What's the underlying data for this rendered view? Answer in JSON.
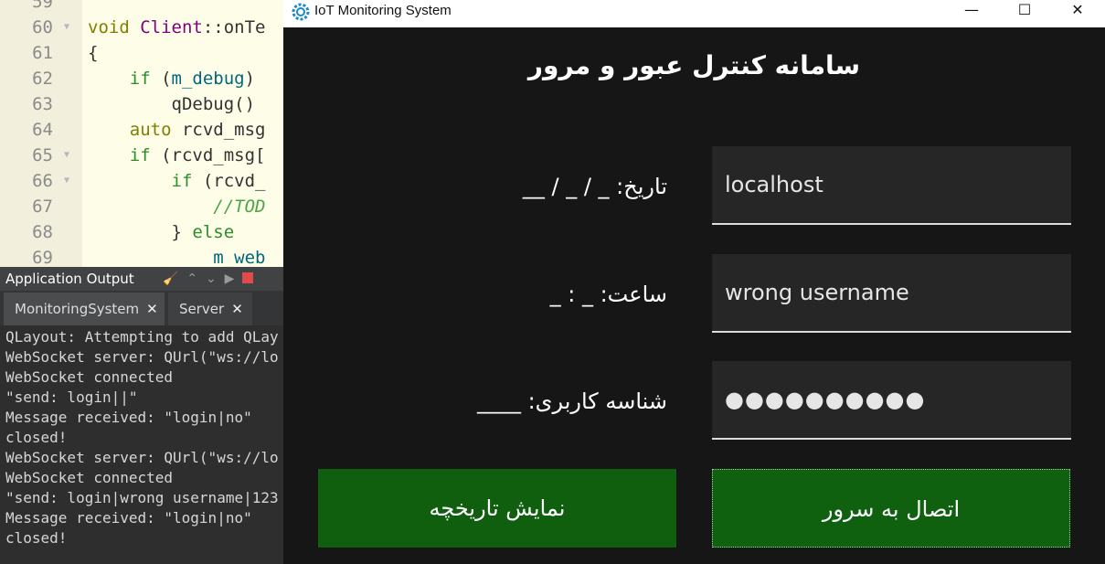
{
  "ide": {
    "code_lines": [
      {
        "num": "59",
        "fold": "",
        "parts": [
          {
            "t": "",
            "c": ""
          }
        ]
      },
      {
        "num": "60",
        "fold": "▼",
        "parts": [
          {
            "t": "void ",
            "c": "kw"
          },
          {
            "t": "Client",
            "c": "cls"
          },
          {
            "t": "::onTe",
            "c": ""
          }
        ]
      },
      {
        "num": "61",
        "fold": "",
        "parts": [
          {
            "t": "{",
            "c": ""
          }
        ]
      },
      {
        "num": "62",
        "fold": "",
        "parts": [
          {
            "t": "    if ",
            "c": "kw2"
          },
          {
            "t": "(",
            "c": ""
          },
          {
            "t": "m_debug",
            "c": "fn"
          },
          {
            "t": ")",
            "c": ""
          }
        ]
      },
      {
        "num": "63",
        "fold": "",
        "parts": [
          {
            "t": "        qDebug()",
            "c": ""
          }
        ]
      },
      {
        "num": "64",
        "fold": "",
        "parts": [
          {
            "t": "    auto ",
            "c": "kw"
          },
          {
            "t": "rcvd_msg",
            "c": ""
          }
        ]
      },
      {
        "num": "65",
        "fold": "▼",
        "parts": [
          {
            "t": "    if ",
            "c": "kw2"
          },
          {
            "t": "(rcvd_msg[",
            "c": ""
          }
        ]
      },
      {
        "num": "66",
        "fold": "▼",
        "parts": [
          {
            "t": "        if ",
            "c": "kw2"
          },
          {
            "t": "(rcvd_",
            "c": ""
          }
        ]
      },
      {
        "num": "67",
        "fold": "",
        "parts": [
          {
            "t": "            //TOD",
            "c": "cmt"
          }
        ]
      },
      {
        "num": "68",
        "fold": "",
        "parts": [
          {
            "t": "        } ",
            "c": ""
          },
          {
            "t": "else",
            "c": "kw2"
          }
        ]
      },
      {
        "num": "69",
        "fold": "",
        "parts": [
          {
            "t": "            m_web",
            "c": "fn"
          }
        ]
      }
    ],
    "output_panel": {
      "title": "Application Output",
      "tabs": [
        {
          "label": "MonitoringSystem",
          "close": "✕"
        },
        {
          "label": "Server",
          "close": "✕"
        }
      ],
      "lines": [
        "QLayout: Attempting to add QLay",
        "WebSocket server: QUrl(\"ws://lo",
        "WebSocket connected",
        "\"send: login||\"",
        "Message received: \"login|no\"",
        "closed!",
        "WebSocket server: QUrl(\"ws://lo",
        "WebSocket connected",
        "\"send: login|wrong username|123",
        "Message received: \"login|no\"",
        "closed!"
      ]
    }
  },
  "window": {
    "title": "IoT Monitoring System",
    "minimize": "—",
    "maximize": "☐",
    "close": "✕"
  },
  "form": {
    "heading": "سامانه کنترل عبور و مرور",
    "date_label": "تاریخ:  _ / _ / __",
    "time_label": "ساعت:  _ : _",
    "user_label": "شناسه کاربری:  ____",
    "host_value": "localhost",
    "username_value": "wrong username",
    "password_dots": "●●●●●●●●●●",
    "history_button": "نمایش تاریخچه",
    "connect_button": "اتصال به سرور"
  },
  "colors": {
    "window_bg": "#161616",
    "field_bg": "#262626",
    "button_green": "#0f5f0f",
    "text": "#ffffff"
  }
}
